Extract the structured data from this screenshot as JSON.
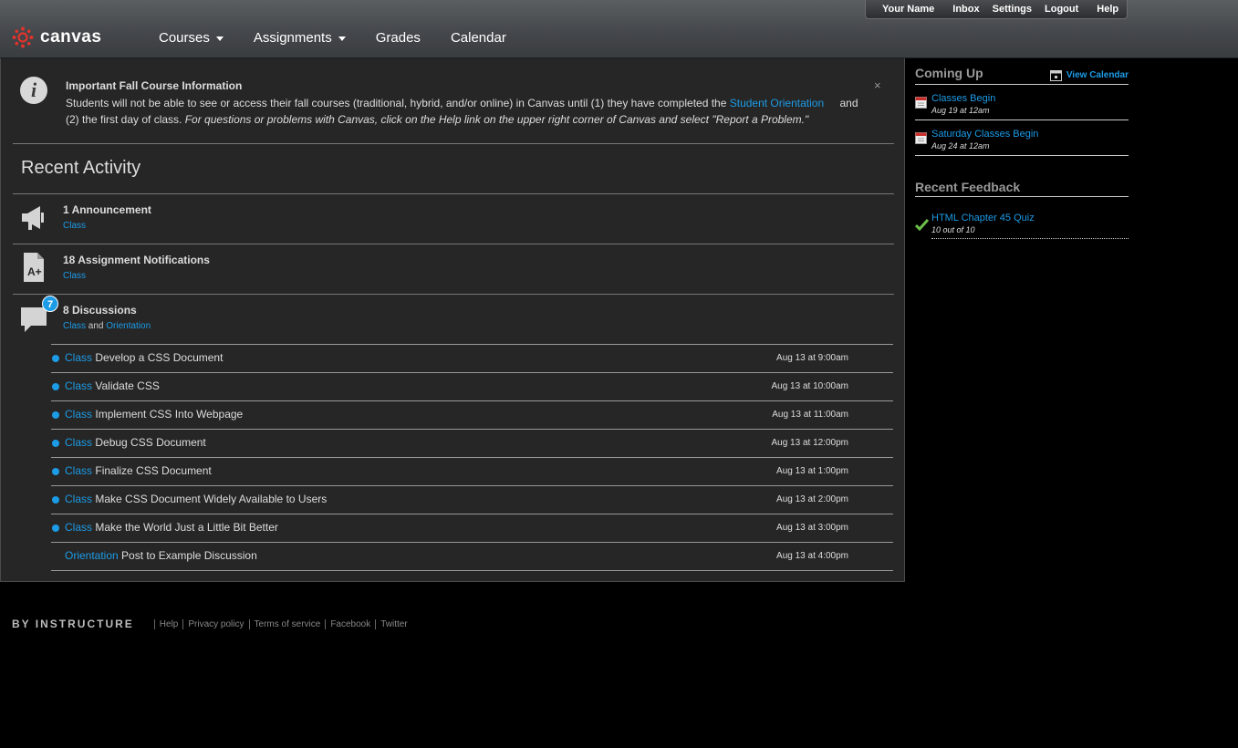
{
  "header": {
    "logo_text": "canvas",
    "nav": [
      {
        "label": "Courses",
        "dropdown": true
      },
      {
        "label": "Assignments",
        "dropdown": true
      },
      {
        "label": "Grades",
        "dropdown": false
      },
      {
        "label": "Calendar",
        "dropdown": false
      }
    ],
    "user_nav": [
      "Your Name",
      "Inbox",
      "Settings",
      "Logout",
      "Help"
    ]
  },
  "announcement": {
    "title": "Important Fall Course Information",
    "body_before_link": "Students will not be able to see or access their fall courses (traditional, hybrid, and/or online) in Canvas until (1) they have completed the ",
    "link_text": "Student Orientation",
    "body_after_link": "and",
    "line2_plain": "(2) the first day of class. ",
    "line2_italic": "For questions or problems with Canvas, click on the Help link on the upper right corner of Canvas and select \"Report a Problem.\"",
    "close": "×"
  },
  "recent_activity": {
    "title": "Recent Activity",
    "items": [
      {
        "title": "1 Announcement",
        "icon": "megaphone-icon",
        "links": [
          "Class"
        ],
        "joiner": ""
      },
      {
        "title": "18 Assignment Notifications",
        "icon": "grade-document-icon",
        "links": [
          "Class"
        ],
        "joiner": ""
      },
      {
        "title": "8 Discussions",
        "icon": "speech-bubble-icon",
        "badge": "7",
        "links": [
          "Class",
          "Orientation"
        ],
        "joiner": " and "
      }
    ],
    "discussions": [
      {
        "course": "Class",
        "title": "Develop a CSS Document",
        "date": "Aug 13 at 9:00am",
        "unread": true
      },
      {
        "course": "Class",
        "title": "Validate CSS",
        "date": "Aug 13 at 10:00am",
        "unread": true
      },
      {
        "course": "Class",
        "title": "Implement CSS Into Webpage",
        "date": "Aug 13 at 11:00am",
        "unread": true
      },
      {
        "course": "Class",
        "title": "Debug CSS Document",
        "date": "Aug 13 at 12:00pm",
        "unread": true
      },
      {
        "course": "Class",
        "title": "Finalize CSS Document",
        "date": "Aug 13 at 1:00pm",
        "unread": true
      },
      {
        "course": "Class",
        "title": "Make CSS Document Widely Available to Users",
        "date": "Aug 13 at 2:00pm",
        "unread": true
      },
      {
        "course": "Class",
        "title": "Make the World Just a Little Bit Better",
        "date": "Aug 13 at 3:00pm",
        "unread": true
      },
      {
        "course": "Orientation",
        "title": "Post to Example Discussion",
        "date": "Aug 13 at 4:00pm",
        "unread": false
      }
    ]
  },
  "sidebar": {
    "coming_up_title": "Coming Up",
    "view_calendar": "View Calendar",
    "events": [
      {
        "title": "Classes Begin",
        "date": "Aug 19 at 12am"
      },
      {
        "title": "Saturday Classes Begin",
        "date": "Aug 24 at 12am"
      }
    ],
    "feedback_title": "Recent Feedback",
    "feedback": {
      "title": "HTML Chapter 45 Quiz",
      "score": "10 out of 10"
    }
  },
  "footer": {
    "brand": "BY INSTRUCTURE",
    "links": [
      "Help",
      "Privacy policy",
      "Terms of service",
      "Facebook",
      "Twitter"
    ]
  },
  "colors": {
    "link": "#1c9be6",
    "background": "#000000",
    "panel": "#262626"
  }
}
